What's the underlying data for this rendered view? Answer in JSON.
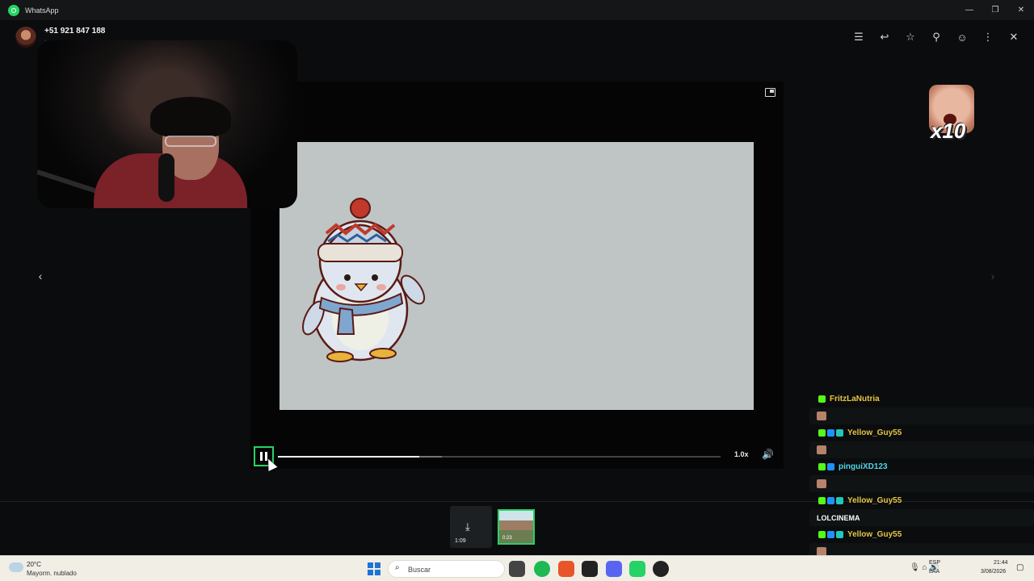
{
  "titlebar": {
    "app_title": "WhatsApp",
    "minimize": "—",
    "maximize": "❐",
    "close": "✕"
  },
  "header": {
    "contact_name": "+51 921 847 188",
    "contact_sub": "·",
    "icons": [
      "message-icon",
      "reply-icon",
      "star-icon",
      "pin-icon",
      "emoji-icon",
      "more-icon",
      "close-icon"
    ],
    "glyphs": {
      "message": "☰",
      "reply": "↩",
      "star": "☆",
      "pin": "⚲",
      "emoji": "☺",
      "more": "⋮",
      "close": "✕"
    }
  },
  "player": {
    "speed": "1.0x",
    "volume_glyph": "🔊",
    "progress": 0.32,
    "buffered": 0.37,
    "prev_glyph": "‹",
    "next_glyph": "›"
  },
  "emote": {
    "multiplier": "x10"
  },
  "thumbnails": [
    {
      "duration": "1:09",
      "download_glyph": "⤓"
    },
    {
      "duration": "0:23",
      "selected": true
    }
  ],
  "chat": [
    {
      "user": "FritzLaNutria",
      "color": "#e6c646",
      "badges": [
        "k"
      ],
      "message": "",
      "emoji": true
    },
    {
      "user": "Yellow_Guy55",
      "color": "#e6c646",
      "badges": [
        "k",
        "s",
        "g"
      ],
      "message": "",
      "emoji": true
    },
    {
      "user": "pinguiXD123",
      "color": "#4fd6e8",
      "badges": [
        "k",
        "s"
      ],
      "message": "",
      "emoji": true
    },
    {
      "user": "Yellow_Guy55",
      "color": "#e6c646",
      "badges": [
        "k",
        "s",
        "g"
      ],
      "message": "LOLCINEMA",
      "emoji": false
    },
    {
      "user": "Yellow_Guy55",
      "color": "#e6c646",
      "badges": [
        "k",
        "s",
        "g"
      ],
      "message": "",
      "emoji": true
    },
    {
      "user": "Yellow_Guy55",
      "color": "#e6c646",
      "badges": [
        "k",
        "s",
        "g"
      ],
      "message": "",
      "emoji": false
    }
  ],
  "taskbar": {
    "temp": "20°C",
    "weather": "Mayorm. nublado",
    "search_placeholder": "Buscar",
    "lang": "ESP",
    "lang_sub": "LAA",
    "time": "21:44",
    "date": "3/08/2026",
    "tray_glyphs": "🎙  ⌂ 🔊"
  },
  "colors": {
    "accent": "#25d366",
    "background": "#0b0c0d"
  }
}
